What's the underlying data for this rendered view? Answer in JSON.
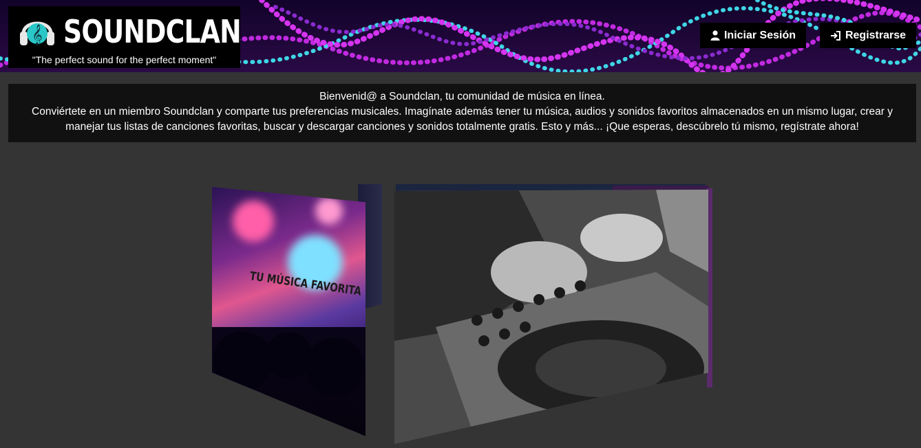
{
  "header": {
    "logo_title": "SOUNDCLAN",
    "tagline": "\"The perfect sound for the perfect moment\"",
    "login_label": "Iniciar Sesión",
    "register_label": "Registrarse"
  },
  "welcome": {
    "line1": "Bienvenid@ a Soundclan, tu comunidad de música en línea.",
    "line2": "Conviértete en un miembro Soundclan y comparte tus preferencias musicales. Imagínate además tener tu música, audios y sonidos favoritos almacenados en un mismo lugar, crear y manejar tus listas de canciones favoritas, buscar y descargar canciones y sonidos totalmente gratis. Esto y más... ¡Que esperas, descúbrelo tú mismo, regístrate ahora!"
  },
  "carousel": {
    "slide_left_text": "TU MÚSICA FAVORITA"
  },
  "icons": {
    "logo": "headphones-music-icon",
    "login": "user-icon",
    "register": "sign-in-icon"
  },
  "colors": {
    "header_bg": "#1a0630",
    "accent_purple": "#b21fd9",
    "accent_cyan": "#3fd6e6",
    "page_bg": "#343434",
    "box_bg": "#111111"
  }
}
